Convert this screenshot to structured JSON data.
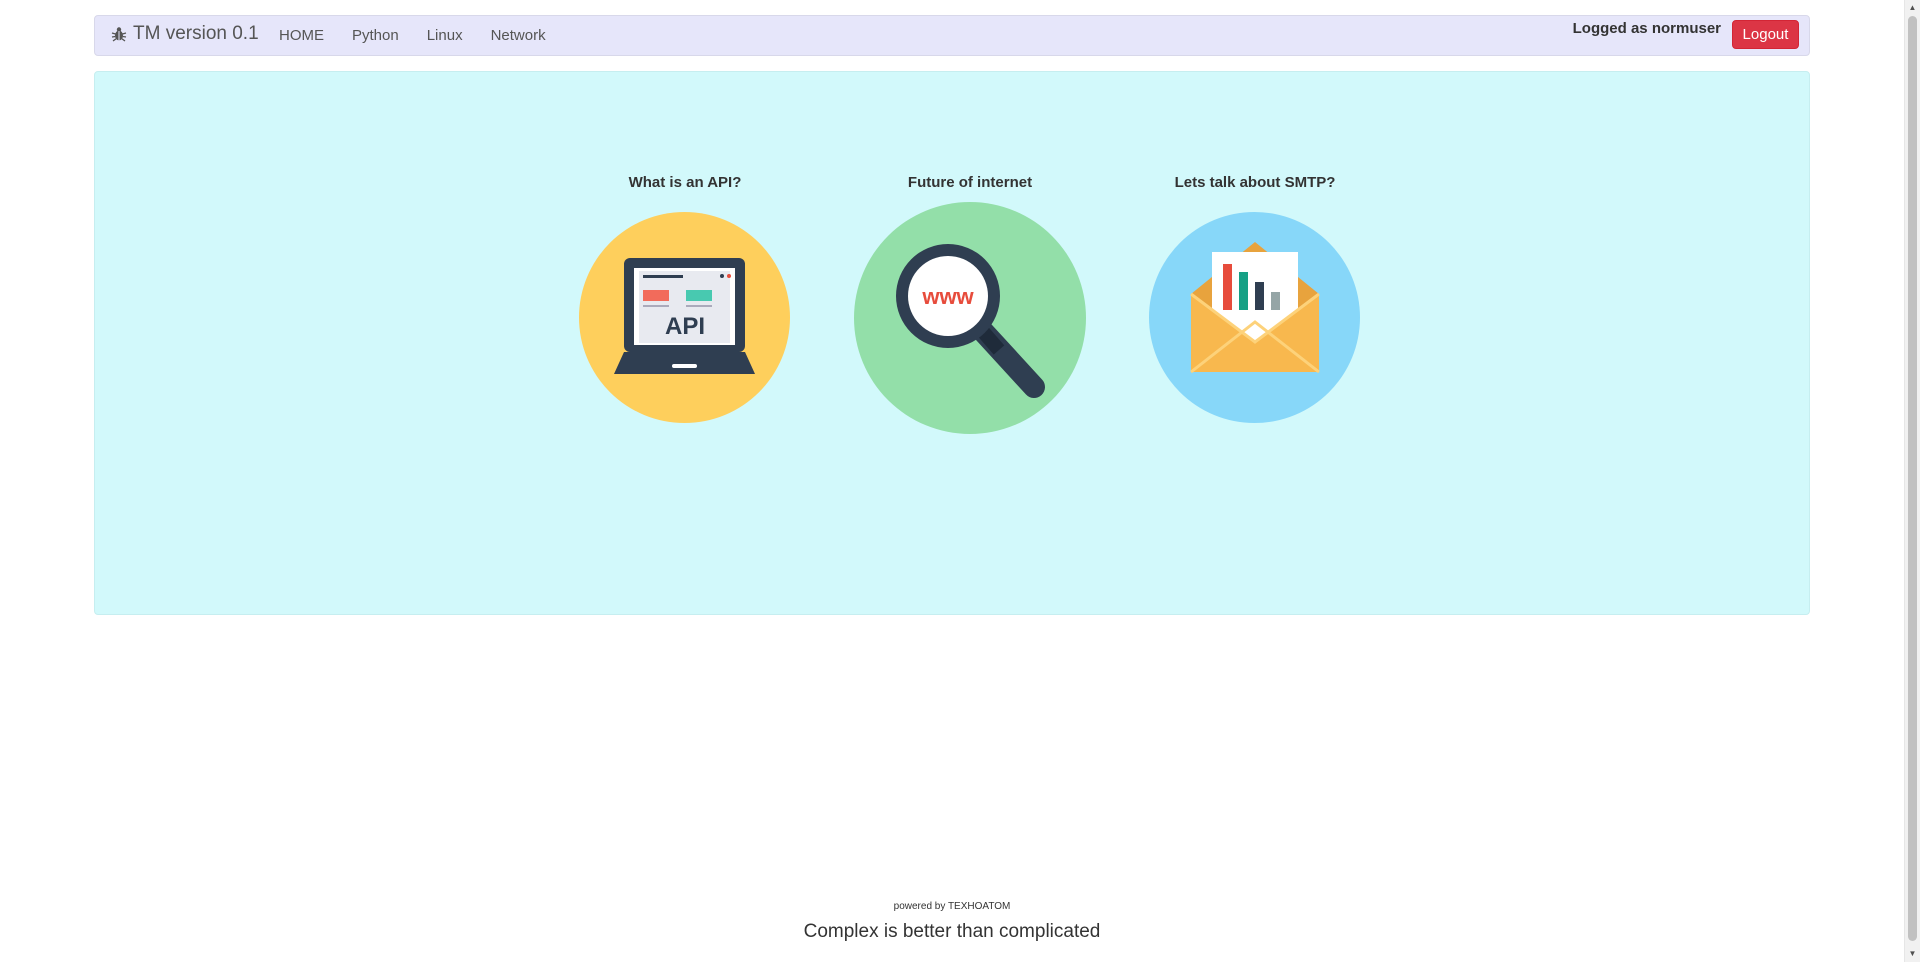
{
  "navbar": {
    "brand": "TM version 0.1",
    "brand_icon": "bug-icon",
    "links": [
      {
        "label": "HOME"
      },
      {
        "label": "Python"
      },
      {
        "label": "Linux"
      },
      {
        "label": "Network"
      }
    ],
    "user_label": "Logged as normuser",
    "logout_label": "Logout"
  },
  "jumbotron": {
    "background": "#d2f9fb",
    "cards": [
      {
        "title": "What is an API?",
        "icon": "laptop-api-icon",
        "circle_color": "#fecf5c",
        "icon_text": "API"
      },
      {
        "title": "Future of internet",
        "icon": "magnifier-www-icon",
        "circle_color": "#93dfa9",
        "icon_text": "www"
      },
      {
        "title": "Lets talk about SMTP?",
        "icon": "envelope-chart-icon",
        "circle_color": "#87d7f9"
      }
    ]
  },
  "footer": {
    "powered": "powered by TEXHOATOM",
    "tagline": "Complex is better than complicated"
  },
  "colors": {
    "navbar_bg": "#e6e6fa",
    "logout_bg": "#dc3545"
  }
}
